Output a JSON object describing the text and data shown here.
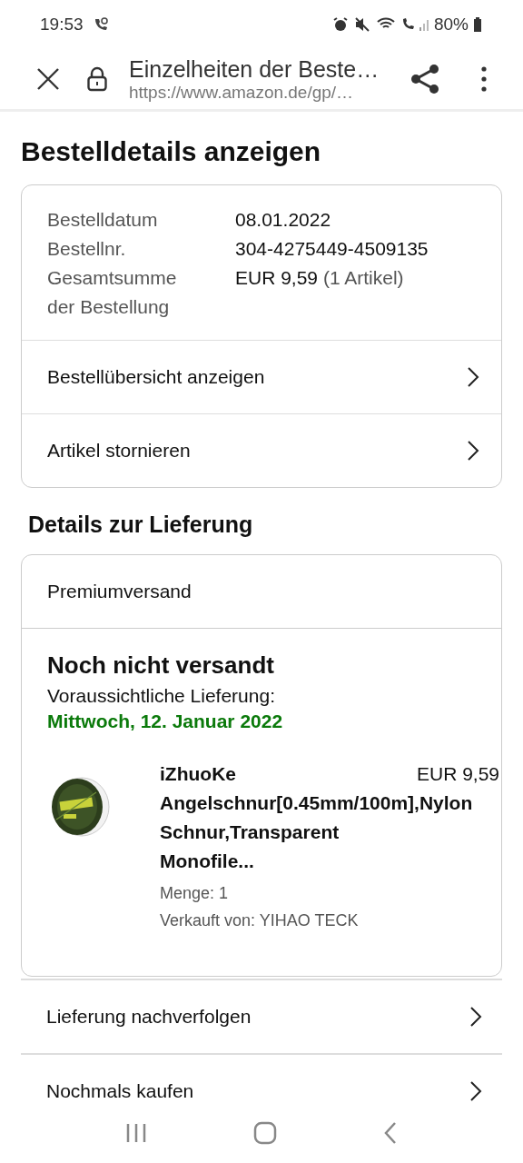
{
  "status_bar": {
    "time": "19:53",
    "battery": "80%"
  },
  "browser": {
    "title": "Einzelheiten der Beste…",
    "url": "https://www.amazon.de/gp/…"
  },
  "heading": "Bestelldetails anzeigen",
  "order": {
    "rows": [
      {
        "label": "Bestelldatum",
        "value": "08.01.2022"
      },
      {
        "label": "Bestellnr.",
        "value": "304-4275449-4509135"
      },
      {
        "label": "Gesamtsumme der Bestellung",
        "value": "EUR 9,59",
        "note": "(1 Artikel)"
      }
    ],
    "links": [
      "Bestellübersicht anzeigen",
      "Artikel stornieren"
    ]
  },
  "delivery": {
    "heading": "Details zur Lieferung",
    "shipping": "Premiumversand",
    "status": "Noch nicht versandt",
    "expected_label": "Voraussichtliche Lieferung:",
    "expected_date": "Mittwoch, 12. Januar 2022",
    "item": {
      "kind": "picture",
      "title_lines": [
        "iZhuoKe",
        "Angelschnur[0.45mm/100m],Nylon",
        "Schnur,Transparent",
        "Monofile..."
      ],
      "price": "EUR 9,59",
      "quantity": "Menge: 1",
      "seller": "Verkauft von: YIHAO TECK"
    }
  },
  "actions": [
    "Lieferung nachverfolgen",
    "Nochmals kaufen"
  ]
}
